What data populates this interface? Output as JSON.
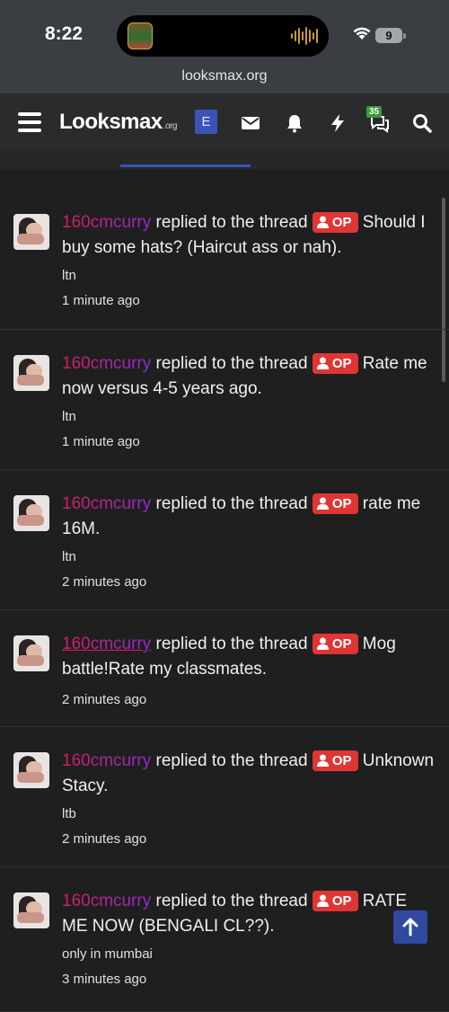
{
  "status": {
    "time": "8:22",
    "battery": "9"
  },
  "browser": {
    "url": "looksmax.org"
  },
  "nav": {
    "logo_main": "Looksmax",
    "logo_suffix": ".org",
    "e_label": "E",
    "conversations_badge": "35",
    "icons": [
      "menu-icon",
      "envelope-icon",
      "bell-icon",
      "bolt-icon",
      "chat-icon",
      "search-icon"
    ]
  },
  "op_label": "OP",
  "verb": "replied to the thread",
  "feed": [
    {
      "user": "160cmcurry",
      "thread": "Should I buy some hats? (Haircut ass or nah).",
      "snippet": "ltn",
      "time": "1 minute ago"
    },
    {
      "user": "160cmcurry",
      "thread": "Rate me now versus 4-5 years ago.",
      "snippet": "ltn",
      "time": "1 minute ago"
    },
    {
      "user": "160cmcurry",
      "thread": "rate me 16M.",
      "snippet": "ltn",
      "time": "2 minutes ago"
    },
    {
      "user": "160cmcurry",
      "thread": "Mog battle!Rate my classmates.",
      "snippet": "",
      "time": "2 minutes ago"
    },
    {
      "user": "160cmcurry",
      "thread": "Unknown Stacy.",
      "snippet": "ltb",
      "time": "2 minutes ago"
    },
    {
      "user": "160cmcurry",
      "thread": "RATE ME NOW (BENGALI CL??).",
      "snippet": "only in mumbai",
      "time": "3 minutes ago"
    }
  ],
  "colors": {
    "op_badge": "#e03535",
    "accent": "#3a53b8",
    "username_start": "#d21f5a",
    "username_end": "#8e2ad1"
  }
}
